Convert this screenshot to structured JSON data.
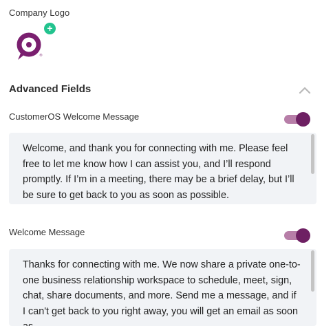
{
  "company_logo": {
    "label": "Company Logo",
    "brand_color": "#7a1f6f",
    "add_icon": "plus-icon"
  },
  "advanced_fields": {
    "title": "Advanced Fields",
    "collapse_icon": "chevron-up-icon",
    "customeros_welcome": {
      "label": "CustomerOS Welcome Message",
      "enabled": true,
      "text": "Welcome, and thank you for connecting with me. Please feel free to let me know how I can assist you, and I’ll respond promptly. If I’m in a meeting, there may be a brief delay, but I’ll be sure to get back to you as soon as possible."
    },
    "welcome_message": {
      "label": "Welcome Message",
      "enabled": true,
      "text": "Thanks for connecting with me. We now share a private one-to-one business relationship workspace to schedule, meet, sign, chat, share documents, and more. Send me a message, and if I can't get back to you right away, you will get an email as soon as"
    }
  },
  "colors": {
    "toggle_track": "#b77ea8",
    "toggle_thumb": "#6e2063",
    "add_badge": "#22c38e",
    "textarea_bg": "#f1f3f6"
  }
}
